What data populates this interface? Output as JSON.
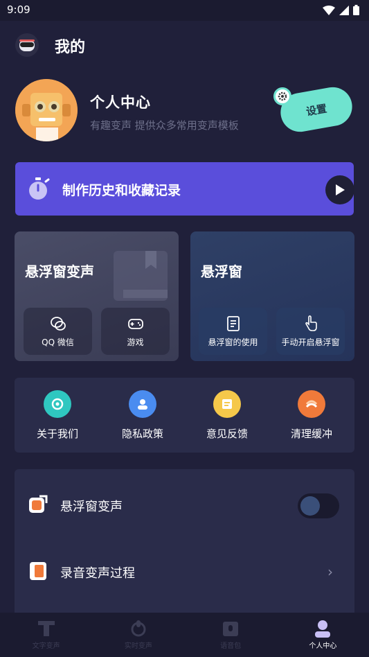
{
  "status_bar": {
    "time": "9:09"
  },
  "header": {
    "title": "我的"
  },
  "profile": {
    "name": "个人中心",
    "subtitle": "有趣变声   提供众多常用变声模板",
    "settings_label": "设置"
  },
  "history": {
    "label": "制作历史和收藏记录"
  },
  "float_cards": {
    "left": {
      "title": "悬浮窗变声",
      "subs": [
        {
          "label": "QQ 微信"
        },
        {
          "label": "游戏"
        }
      ]
    },
    "right": {
      "title": "悬浮窗",
      "subs": [
        {
          "label": "悬浮窗的使用"
        },
        {
          "label": "手动开启悬浮窗"
        }
      ]
    }
  },
  "quick_actions": [
    {
      "label": "关于我们",
      "color": "#2fc7c0"
    },
    {
      "label": "隐私政策",
      "color": "#4a8cf0"
    },
    {
      "label": "意见反馈",
      "color": "#f5c84a"
    },
    {
      "label": "清理缓冲",
      "color": "#f07a3a"
    }
  ],
  "settings_list": [
    {
      "label": "悬浮窗变声",
      "toggle": false
    },
    {
      "label": "录音变声过程"
    }
  ],
  "bottom_nav": [
    {
      "label": "文字变声",
      "icon": "text-T-icon"
    },
    {
      "label": "实时变声",
      "icon": "mic-hand-icon"
    },
    {
      "label": "语音包",
      "icon": "voice-pack-icon"
    },
    {
      "label": "个人中心",
      "icon": "person-icon",
      "active": true
    }
  ],
  "colors": {
    "background": "#20203a",
    "accent_purple": "#5a4edb",
    "accent_mint": "#6fe3cf"
  }
}
